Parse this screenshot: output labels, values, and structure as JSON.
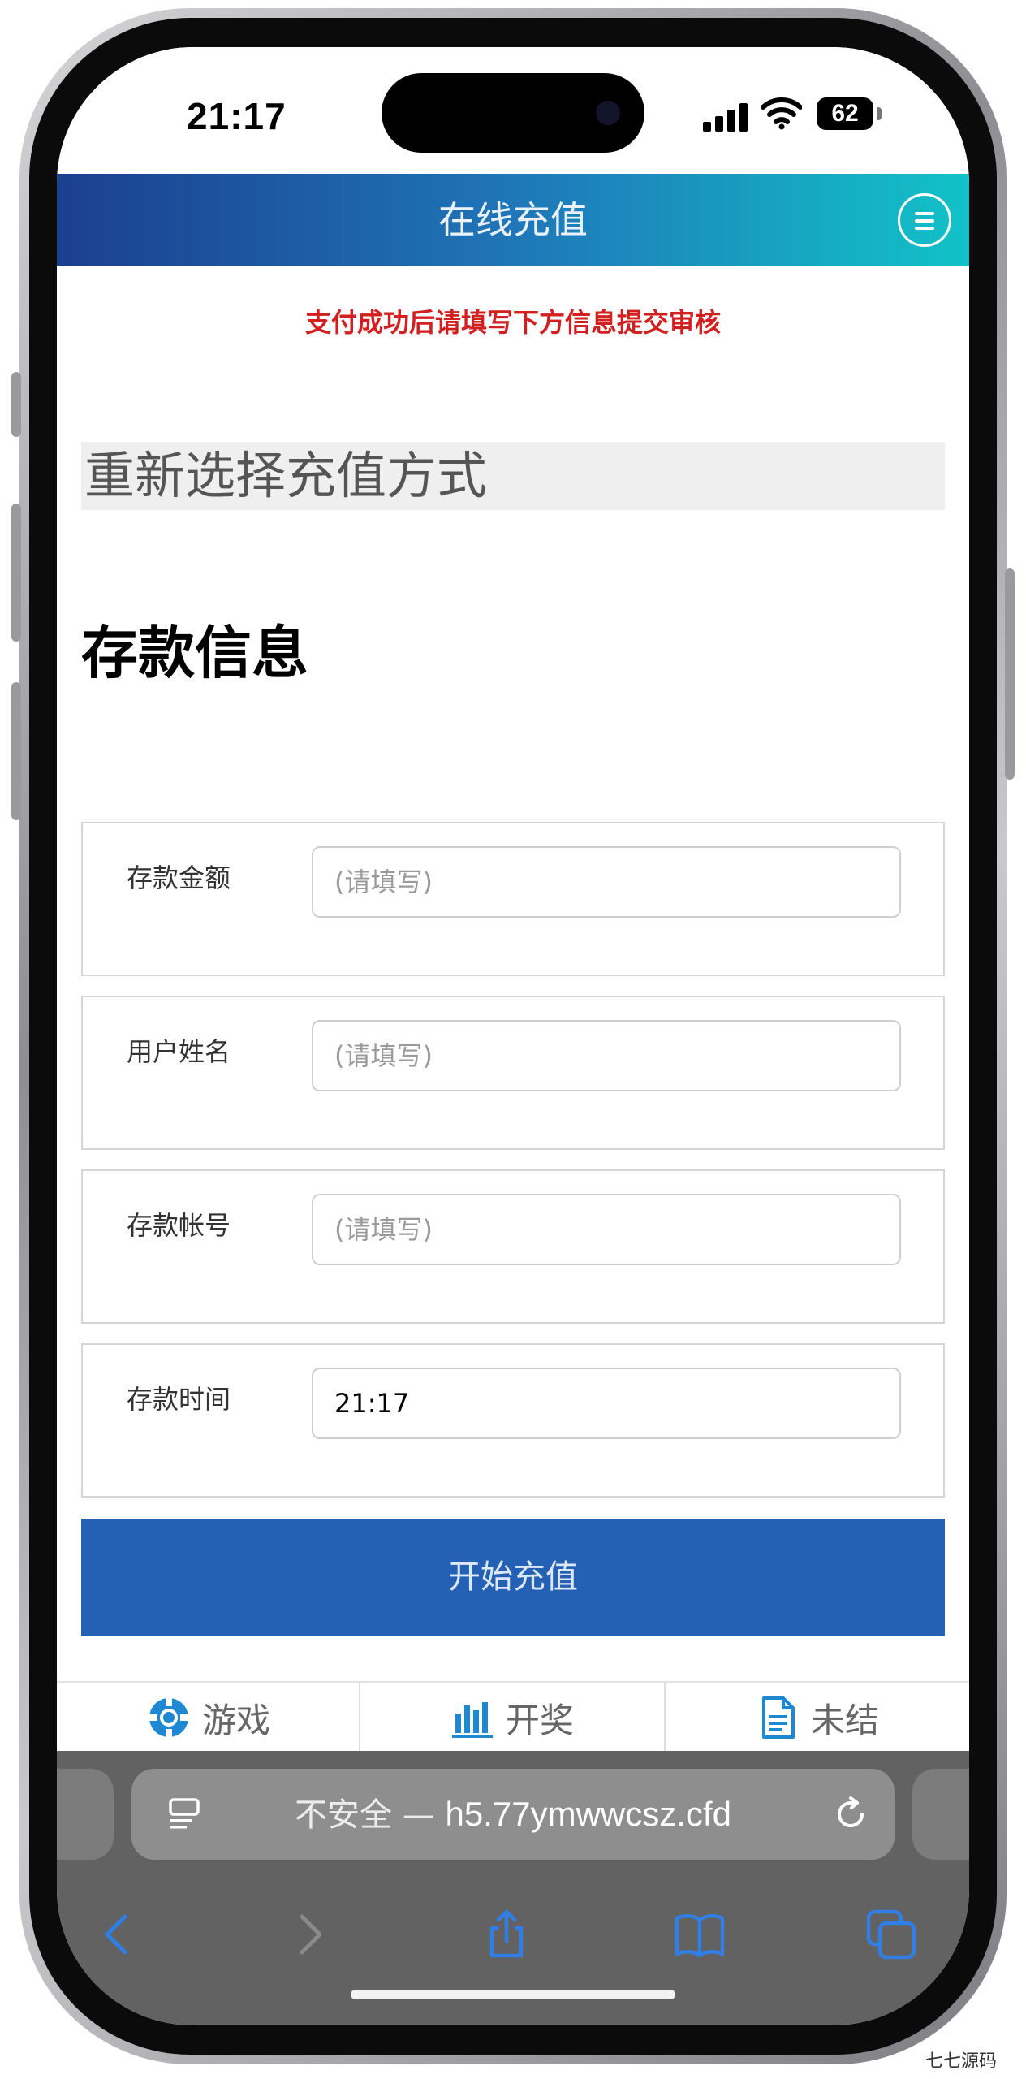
{
  "status_bar": {
    "time": "21:17",
    "battery": "62"
  },
  "header": {
    "title": "在线充值",
    "menu_icon": "hamburger-menu-icon"
  },
  "notice": "支付成功后请填写下方信息提交审核",
  "reselect_label": "重新选择充值方式",
  "section_title": "存款信息",
  "form": {
    "fields": [
      {
        "label": "存款金额",
        "placeholder": "(请填写)",
        "value": ""
      },
      {
        "label": "用户姓名",
        "placeholder": "(请填写)",
        "value": ""
      },
      {
        "label": "存款帐号",
        "placeholder": "(请填写)",
        "value": ""
      },
      {
        "label": "存款时间",
        "placeholder": "",
        "value": "21:17"
      }
    ],
    "submit_label": "开始充值"
  },
  "tabs": [
    {
      "label": "游戏",
      "icon": "game-chip-icon"
    },
    {
      "label": "开奖",
      "icon": "bar-chart-icon"
    },
    {
      "label": "未结",
      "icon": "document-icon"
    }
  ],
  "safari": {
    "security_label": "不安全 — ",
    "host": "h5.77ymwwcsz.cfd"
  },
  "watermark": "七七源码",
  "colors": {
    "header_start": "#1b3f8f",
    "header_end": "#12c2c8",
    "notice": "#d21f1f",
    "submit": "#2461b4",
    "tab_icon": "#1e88d2"
  }
}
